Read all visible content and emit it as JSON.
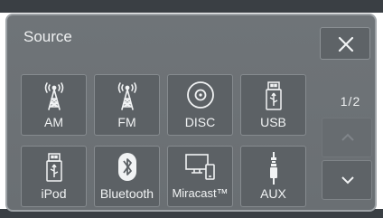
{
  "header": {
    "title": "Source",
    "close_icon": "close-icon"
  },
  "sources": [
    {
      "label": "AM",
      "icon": "antenna-icon"
    },
    {
      "label": "FM",
      "icon": "antenna-icon"
    },
    {
      "label": "DISC",
      "icon": "disc-icon"
    },
    {
      "label": "USB",
      "icon": "usb-icon"
    },
    {
      "label": "iPod",
      "icon": "usb-icon"
    },
    {
      "label": "Bluetooth",
      "icon": "bluetooth-icon"
    },
    {
      "label": "Miracast™",
      "icon": "miracast-icon"
    },
    {
      "label": "AUX",
      "icon": "aux-plug-icon"
    }
  ],
  "pagination": {
    "indicator": "1/2",
    "up_icon": "chevron-up-icon",
    "down_icon": "chevron-down-icon",
    "up_enabled": false
  },
  "colors": {
    "panel": "#6c7175",
    "tile": "#5c6165",
    "border": "#868b8f",
    "text": "#f1f3f4"
  }
}
